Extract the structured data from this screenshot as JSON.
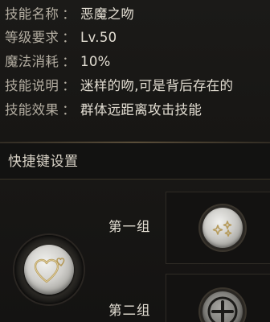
{
  "skill_info": {
    "rows": [
      {
        "key": "技能名称",
        "sep": "：",
        "value": "恶魔之吻"
      },
      {
        "key": "等级要求",
        "sep": "：",
        "value": "Lv.50"
      },
      {
        "key": "魔法消耗",
        "sep": "：",
        "value": "10%"
      },
      {
        "key": "技能说明",
        "sep": "：",
        "value": "迷样的吻,可是背后存在的"
      },
      {
        "key": "技能效果",
        "sep": "：",
        "value": "群体远距离攻击技能"
      }
    ]
  },
  "hotkey": {
    "title": "快捷键设置",
    "skill_icon": "heart-kiss-icon",
    "groups": [
      {
        "label": "第一组",
        "slot_icon": "sparkle-stars-icon",
        "slot_state": "assigned"
      },
      {
        "label": "第二组",
        "slot_icon": "plus-icon",
        "slot_state": "empty"
      }
    ]
  },
  "colors": {
    "label_text": "#b3ada1",
    "value_text": "#e2ddd2",
    "icon_gold": "#b59a5a"
  }
}
